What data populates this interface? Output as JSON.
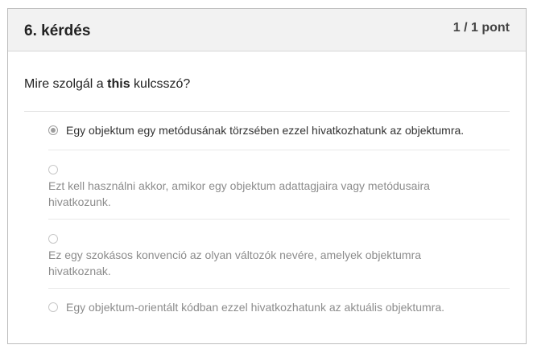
{
  "question": {
    "title": "6. kérdés",
    "points": "1 / 1 pont",
    "text_before": "Mire szolgál a ",
    "text_keyword": "this",
    "text_after": " kulcsszó?"
  },
  "answers": [
    {
      "label": "Egy objektum egy metódusának törzsében ezzel hivatkozhatunk az objektumra.",
      "selected": true
    },
    {
      "label": "Ezt kell használni akkor, amikor egy objektum adattagjaira vagy metódusaira hivatkozunk.",
      "selected": false
    },
    {
      "label": "Ez egy szokásos konvenció az olyan változók nevére, amelyek objektumra hivatkoznak.",
      "selected": false
    },
    {
      "label": "Egy objektum-orientált kódban ezzel hivatkozhatunk az aktuális objektumra.",
      "selected": false
    }
  ],
  "colors": {
    "header_bg": "#f2f2f2",
    "border": "#bdbdbd",
    "selected_radio": "#9e9e9e",
    "muted_text": "#8c8c8c"
  }
}
